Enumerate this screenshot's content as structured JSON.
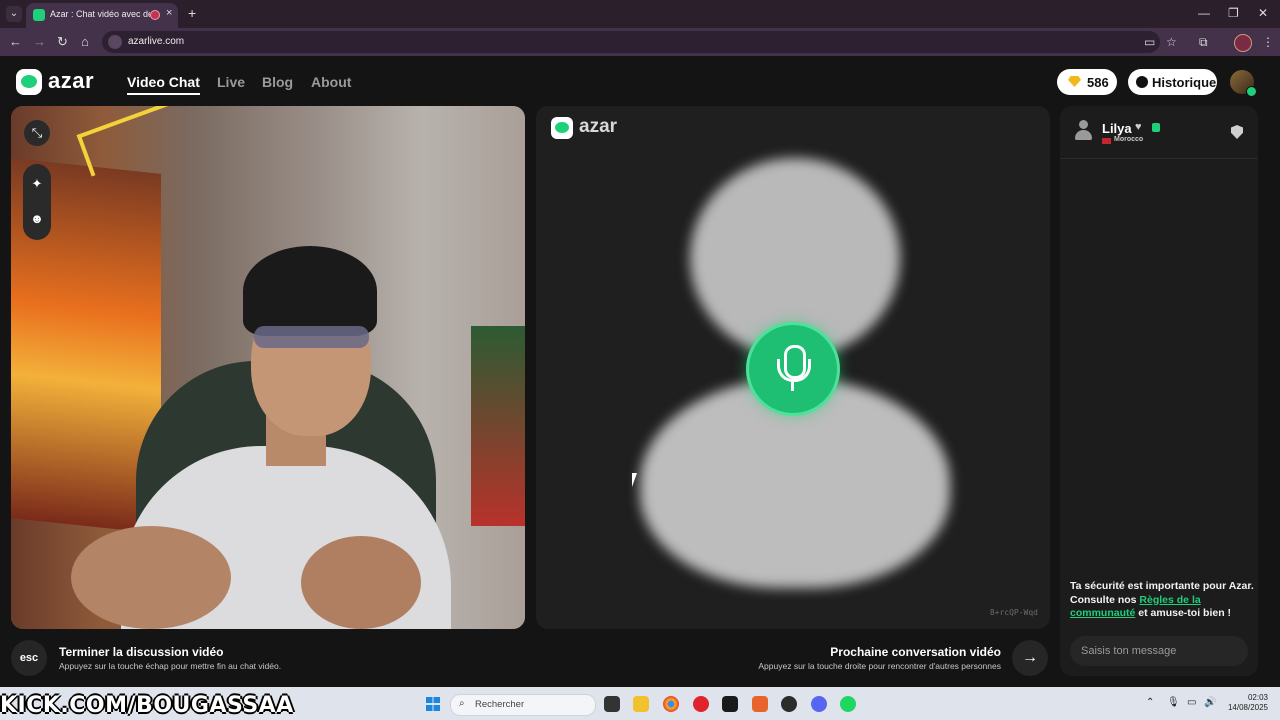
{
  "browser": {
    "tab_title": "Azar : Chat vidéo avec de n",
    "new_tab": "+",
    "url": "azarlive.com",
    "minimize": "—",
    "restore": "❐",
    "close": "✕"
  },
  "site": {
    "logo": "azar",
    "nav": [
      "Video Chat",
      "Live",
      "Blog",
      "About"
    ],
    "gems": "586",
    "history_label": "Historique"
  },
  "remote": {
    "logo": "azar",
    "peer_id": "8+rcQP-Wqd"
  },
  "chat": {
    "name": "Lilya",
    "heart": "♥",
    "country": "Morocco",
    "safety_prefix": "Ta sécurité est importante pour Azar. Consulte nos ",
    "safety_link": "Règles de la communauté",
    "safety_suffix": " et amuse-toi bien !",
    "input_placeholder": "Saisis ton message"
  },
  "hints": {
    "esc_key": "esc",
    "end_title": "Terminer la discussion vidéo",
    "end_sub": "Appuyez sur la touche échap pour mettre fin au chat vidéo.",
    "next_title": "Prochaine conversation vidéo",
    "next_sub": "Appuyez sur la touche droite pour rencontrer d'autres personnes",
    "next_key": "→"
  },
  "overlay": {
    "stream_url": "KICK.COM/BOUGASSAA"
  },
  "taskbar": {
    "search_placeholder": "Rechercher",
    "time": "02:03",
    "date": "14/08/2025"
  },
  "colors": {
    "accent": "#1fd07a",
    "page_bg": "#141414",
    "panel_bg": "#1c1c1c"
  }
}
